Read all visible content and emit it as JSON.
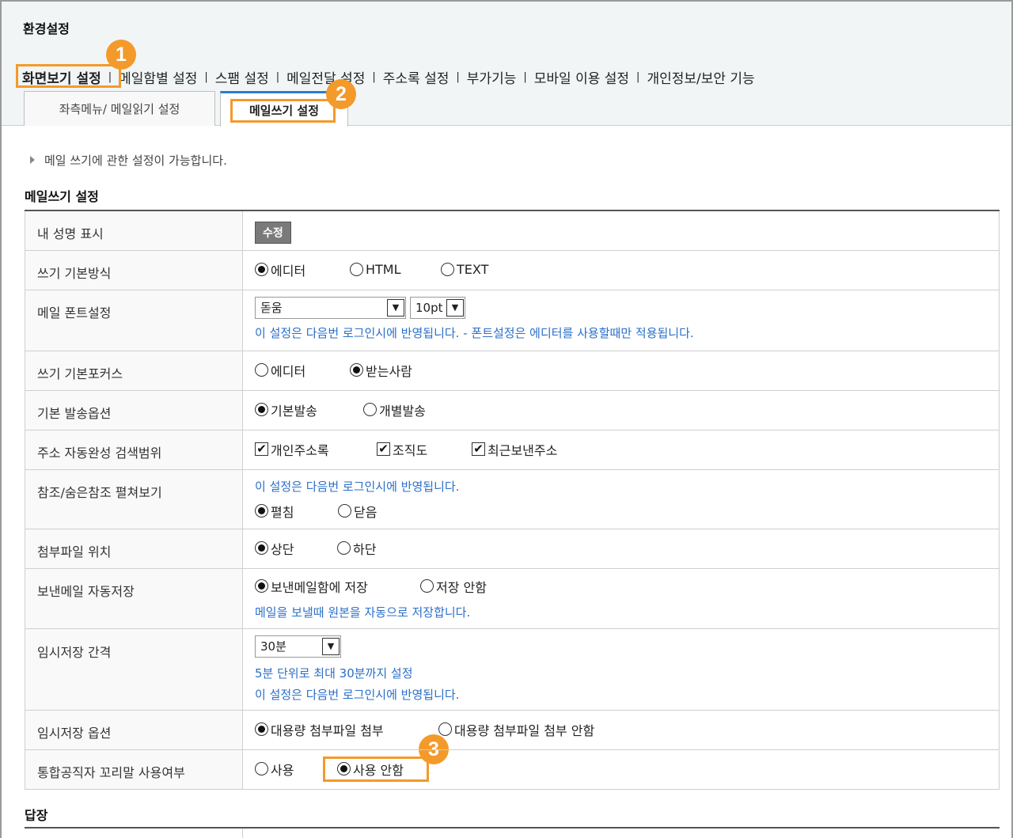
{
  "page_title": "환경설정",
  "topnav": [
    "화면보기 설정",
    "메일함별 설정",
    "스팸 설정",
    "메일전달 설정",
    "주소록 설정",
    "부가기능",
    "모바일 이용 설정",
    "개인정보/보안 기능"
  ],
  "topnav_separator": "|",
  "subtabs": [
    "좌측메뉴/ 메일읽기 설정",
    "메일쓰기 설정"
  ],
  "badges": [
    "1",
    "2",
    "3"
  ],
  "info_text": "메일 쓰기에 관한 설정이 가능합니다.",
  "section_title": "메일쓰기 설정",
  "rows": {
    "signature": {
      "label": "내 성명 표시",
      "button": "수정"
    },
    "write_mode": {
      "label": "쓰기 기본방식",
      "options": [
        "에디터",
        "HTML",
        "TEXT"
      ],
      "selected": "에디터"
    },
    "font": {
      "label": "메일 폰트설정",
      "font_value": "돋움",
      "size_value": "10pt",
      "note": "이 설정은 다음번 로그인시에 반영됩니다. - 폰트설정은 에디터를 사용할때만 적용됩니다."
    },
    "focus": {
      "label": "쓰기 기본포커스",
      "options": [
        "에디터",
        "받는사람"
      ],
      "selected": "받는사람"
    },
    "send_option": {
      "label": "기본 발송옵션",
      "options": [
        "기본발송",
        "개별발송"
      ],
      "selected": "기본발송"
    },
    "autocomplete": {
      "label": "주소 자동완성 검색범위",
      "options": [
        "개인주소록",
        "조직도",
        "최근보낸주소"
      ],
      "checked": [
        true,
        true,
        true
      ]
    },
    "cc_expand": {
      "label": "참조/숨은참조 펼쳐보기",
      "note": "이 설정은 다음번 로그인시에 반영됩니다.",
      "options": [
        "펼침",
        "닫음"
      ],
      "selected": "펼침"
    },
    "attach_pos": {
      "label": "첨부파일 위치",
      "options": [
        "상단",
        "하단"
      ],
      "selected": "상단"
    },
    "sent_save": {
      "label": "보낸메일 자동저장",
      "options": [
        "보낸메일함에 저장",
        "저장 안함"
      ],
      "selected": "보낸메일함에 저장",
      "note": "메일을 보낼때 원본을 자동으로 저장합니다."
    },
    "temp_interval": {
      "label": "임시저장 간격",
      "value": "30분",
      "note1": "5분 단위로 최대 30분까지 설정",
      "note2": "이 설정은 다음번 로그인시에 반영됩니다."
    },
    "temp_option": {
      "label": "임시저장 옵션",
      "options": [
        "대용량 첨부파일 첨부",
        "대용량 첨부파일 첨부 안함"
      ],
      "selected": "대용량 첨부파일 첨부"
    },
    "footer": {
      "label": "통합공직자 꼬리말 사용여부",
      "options": [
        "사용",
        "사용 안함"
      ],
      "selected": "사용 안함"
    }
  },
  "reply_title": "답장",
  "colors": {
    "accent_orange": "#f39a2b",
    "note_blue": "#2a6fc9",
    "tab_blue": "#2c7bd6"
  }
}
